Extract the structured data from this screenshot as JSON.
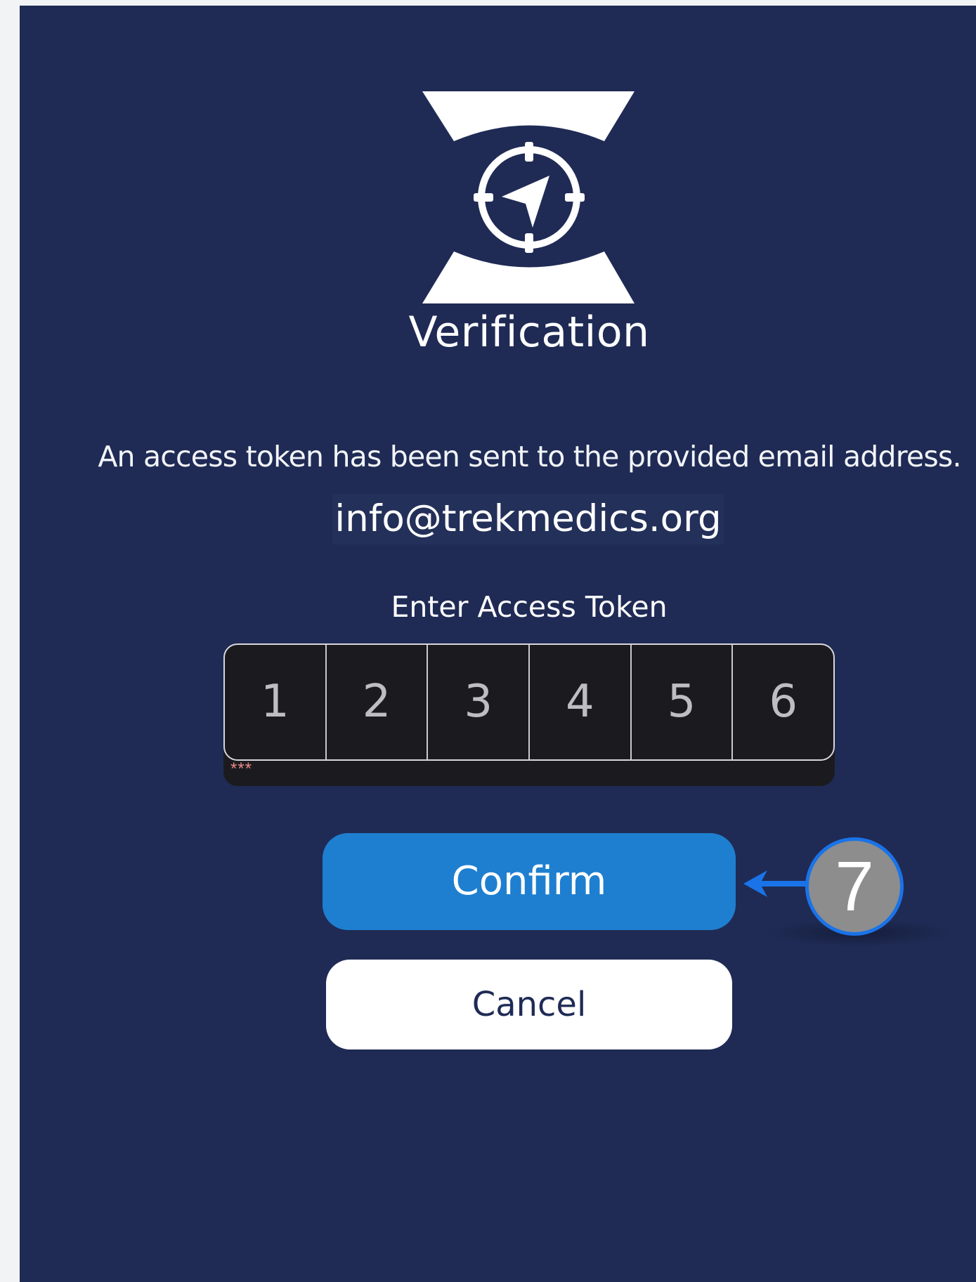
{
  "screen": {
    "title": "Verification",
    "message": "An access token has been sent to the provided email address.",
    "email": "info@trekmedics.org"
  },
  "token": {
    "label": "Enter Access Token",
    "digits": [
      "1",
      "2",
      "3",
      "4",
      "5",
      "6"
    ],
    "mask": "***"
  },
  "buttons": {
    "confirm_label": "Confirm",
    "cancel_label": "Cancel"
  },
  "callout": {
    "number": "7"
  },
  "colors": {
    "background": "#1f2b55",
    "confirm": "#1e7fd0",
    "callout_ring": "#1a73e8"
  },
  "icons": {
    "logo": "hourglass-compass-logo",
    "callout_arrow": "arrow-left-icon"
  }
}
